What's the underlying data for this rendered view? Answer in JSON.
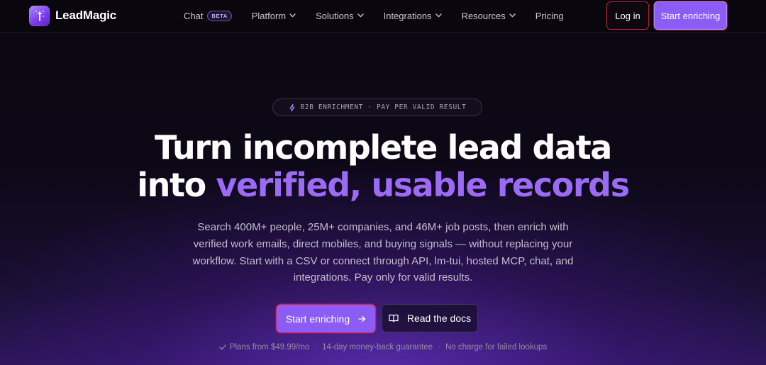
{
  "brand": {
    "name": "LeadMagic",
    "accent_color": "#8b5cf6"
  },
  "nav": {
    "items": [
      {
        "label": "Chat",
        "badge": "BETA",
        "icon": "none"
      },
      {
        "label": "Platform",
        "icon": "chevron-down-icon"
      },
      {
        "label": "Solutions",
        "icon": "chevron-down-icon"
      },
      {
        "label": "Integrations",
        "icon": "chevron-down-icon"
      },
      {
        "label": "Resources",
        "icon": "chevron-down-icon"
      },
      {
        "label": "Pricing",
        "icon": "none"
      }
    ],
    "login_label": "Log in",
    "start_label": "Start enriching"
  },
  "hero": {
    "pill_text": "B2B ENRICHMENT · PAY PER VALID RESULT",
    "headline_line1": "Turn incomplete lead data",
    "headline_line2_plain": "into ",
    "headline_line2_accent": "verified, usable records",
    "subtext": "Search 400M+ people, 25M+ companies, and 46M+ job posts, then enrich with verified work emails, direct mobiles, and buying signals — without replacing your workflow. Start with a CSV or connect through API, lm-tui, hosted MCP, chat, and integrations. Pay only for valid results.",
    "cta_primary": "Start enriching",
    "cta_secondary": "Read the docs",
    "trust_items": [
      "Plans from $49.99/mo",
      "14-day money-back guarantee",
      "No charge for failed lookups"
    ],
    "separator": "·"
  }
}
